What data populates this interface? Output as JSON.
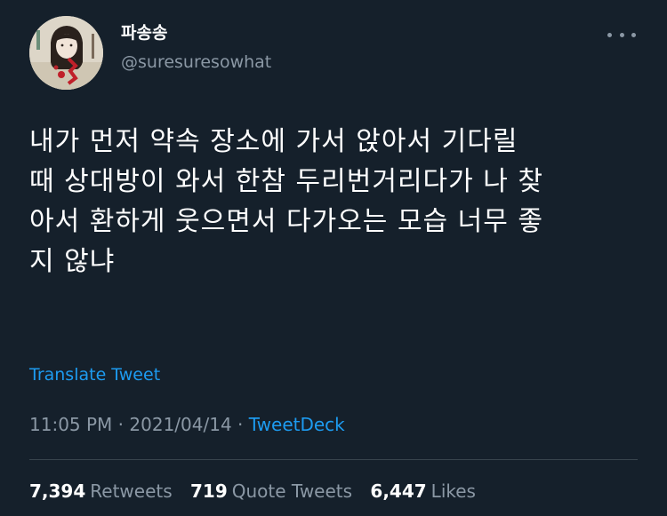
{
  "user": {
    "display_name": "파송송",
    "handle": "@suresuresowhat",
    "avatar_icon": "profile-photo"
  },
  "tweet": {
    "lines": [
      "내가 먼저 약속 장소에 가서 앉아서 기다릴",
      "때 상대방이 와서 한참 두리번거리다가 나 찾",
      "아서 환하게 웃으면서 다가오는 모습 너무 좋",
      "지 않냐"
    ],
    "translate_label": "Translate Tweet",
    "time": "11:05 PM",
    "separator": "·",
    "date": "2021/04/14",
    "source": "TweetDeck"
  },
  "stats": {
    "retweets_count": "7,394",
    "retweets_label": "Retweets",
    "quotes_count": "719",
    "quotes_label": "Quote Tweets",
    "likes_count": "6,447",
    "likes_label": "Likes"
  },
  "colors": {
    "background": "#15202b",
    "text_primary": "#ffffff",
    "text_secondary": "#8b98a5",
    "accent": "#1d9bf0",
    "divider": "#38444d"
  }
}
